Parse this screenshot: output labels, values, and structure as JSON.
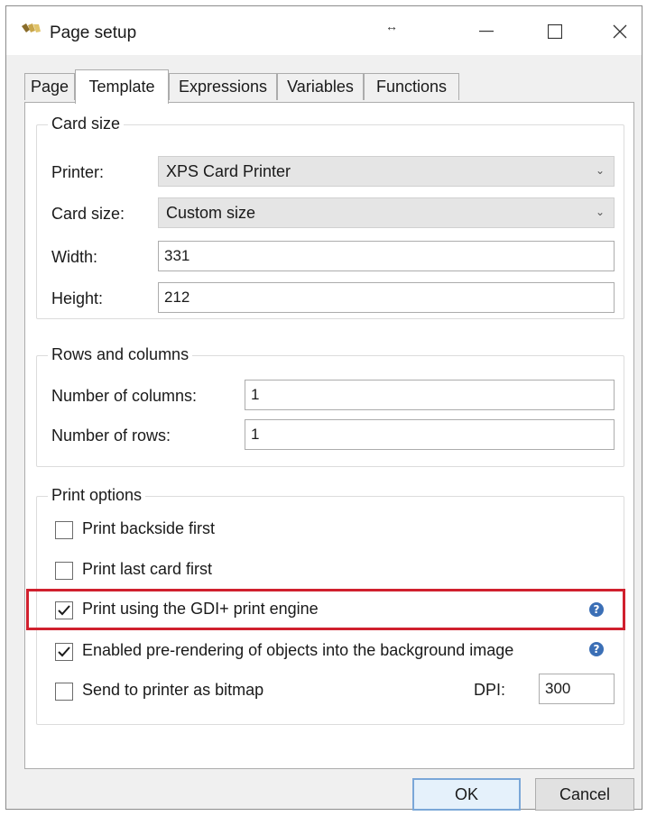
{
  "window": {
    "title": "Page setup",
    "resize_glyph": "↔"
  },
  "tabs": [
    {
      "label": "Page",
      "active": false
    },
    {
      "label": "Template",
      "active": true
    },
    {
      "label": "Expressions",
      "active": false
    },
    {
      "label": "Variables",
      "active": false
    },
    {
      "label": "Functions",
      "active": false
    }
  ],
  "card_size": {
    "title": "Card size",
    "printer_label": "Printer:",
    "printer_value": "XPS Card Printer",
    "card_size_label": "Card size:",
    "card_size_value": "Custom size",
    "width_label": "Width:",
    "width_value": "331",
    "height_label": "Height:",
    "height_value": "212"
  },
  "rows_columns": {
    "title": "Rows and columns",
    "columns_label": "Number of columns:",
    "columns_value": "1",
    "rows_label": "Number of rows:",
    "rows_value": "1"
  },
  "print_options": {
    "title": "Print options",
    "items": [
      {
        "label": "Print backside first",
        "checked": false
      },
      {
        "label": "Print last card first",
        "checked": false
      },
      {
        "label": "Print using the GDI+ print engine",
        "checked": true
      },
      {
        "label": "Enabled pre-rendering of objects into the background image",
        "checked": true
      },
      {
        "label": "Send to printer as bitmap",
        "checked": false
      }
    ],
    "dpi_label": "DPI:",
    "dpi_value": "300",
    "help_glyph": "?"
  },
  "buttons": {
    "ok": "OK",
    "cancel": "Cancel"
  },
  "colors": {
    "highlight": "#d0202e",
    "help_icon": "#3b6fb6",
    "default_button_border": "#7aa7d8"
  }
}
